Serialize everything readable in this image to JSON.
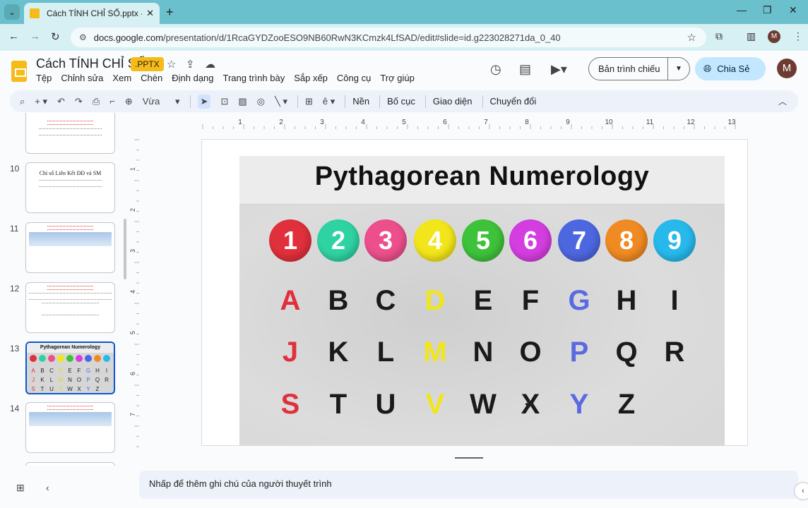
{
  "browser": {
    "tab_title": "Cách TÍNH CHỈ SỐ.pptx - Googl",
    "tab_close": "✕",
    "new_tab": "+",
    "url_domain": "docs.google.com",
    "url_path": "/presentation/d/1RcaGYDZooESO9NB60RwN3KCmzk4LfSAD/edit#slide=id.g223028271da_0_40",
    "profile_initial": "M"
  },
  "doc": {
    "title": "Cách TÍNH CHỈ SỐ",
    "badge": ".PPTX",
    "menu": [
      "Tệp",
      "Chỉnh sửa",
      "Xem",
      "Chèn",
      "Định dạng",
      "Trang trình bày",
      "Sắp xếp",
      "Công cụ",
      "Trợ giúp"
    ],
    "present_label": "Bản trình chiếu",
    "share_label": "Chia Sẻ",
    "avatar_initial": "M"
  },
  "toolbar": {
    "zoom_label": "Vừa",
    "background": "Nền",
    "layout": "Bố cục",
    "theme": "Giao diện",
    "transition": "Chuyển đổi"
  },
  "filmstrip": {
    "slides": [
      {
        "num": "10",
        "title": "Chỉ số Liên Kết ĐĐ và SM"
      },
      {
        "num": "11"
      },
      {
        "num": "12"
      },
      {
        "num": "13",
        "title": "Pythagorean Numerology"
      },
      {
        "num": "14"
      }
    ]
  },
  "ruler": {
    "h_labels": [
      "1",
      "2",
      "3",
      "4",
      "5",
      "6",
      "7",
      "8",
      "9",
      "10",
      "11",
      "12",
      "13"
    ],
    "v_labels": [
      "1",
      "2",
      "3",
      "4",
      "5",
      "6",
      "7"
    ]
  },
  "slide": {
    "image_title": "Pythagorean Numerology",
    "numbers": [
      {
        "n": "1",
        "color": "#e0303c"
      },
      {
        "n": "2",
        "color": "#2fd3a3"
      },
      {
        "n": "3",
        "color": "#ec4f8c"
      },
      {
        "n": "4",
        "color": "#f2e51a"
      },
      {
        "n": "5",
        "color": "#3ec23a"
      },
      {
        "n": "6",
        "color": "#d43ee0"
      },
      {
        "n": "7",
        "color": "#4d67e0"
      },
      {
        "n": "8",
        "color": "#f08a22"
      },
      {
        "n": "9",
        "color": "#27b9ec"
      }
    ],
    "rows": [
      [
        "A",
        "B",
        "C",
        "D",
        "E",
        "F",
        "G",
        "H",
        "I"
      ],
      [
        "J",
        "K",
        "L",
        "M",
        "N",
        "O",
        "P",
        "Q",
        "R"
      ],
      [
        "S",
        "T",
        "U",
        "V",
        "W",
        "X",
        "Y",
        "Z",
        ""
      ]
    ],
    "letter_colors": [
      "#e0303c",
      "#1a1a1a",
      "#1a1a1a",
      "#f2e51a",
      "#1a1a1a",
      "#1a1a1a",
      "#5a6ae0",
      "#1a1a1a",
      "#1a1a1a"
    ]
  },
  "notes": {
    "placeholder": "Nhấp để thêm ghi chú của người thuyết trình"
  }
}
